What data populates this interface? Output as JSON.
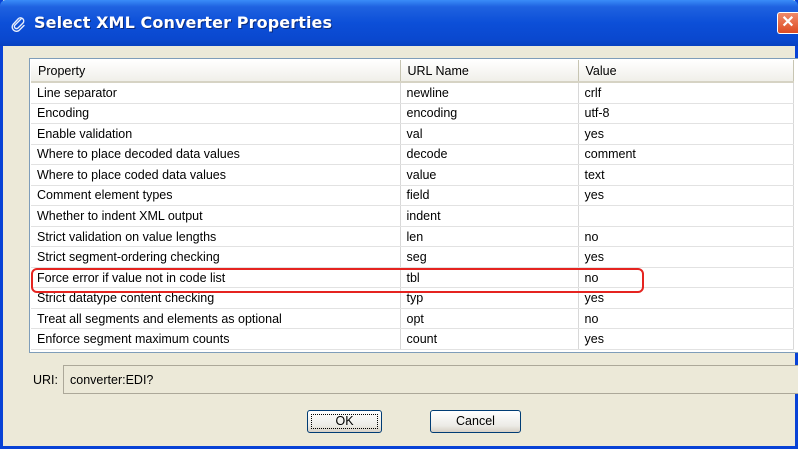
{
  "window": {
    "title": "Select XML Converter Properties",
    "close_glyph": "✕",
    "icon": "paperclip-icon"
  },
  "table": {
    "columns": [
      "Property",
      "URL Name",
      "Value"
    ],
    "rows": [
      {
        "property": "Line separator",
        "url": "newline",
        "value": "crlf"
      },
      {
        "property": "Encoding",
        "url": "encoding",
        "value": "utf-8"
      },
      {
        "property": "Enable validation",
        "url": "val",
        "value": "yes"
      },
      {
        "property": "Where to place decoded data values",
        "url": "decode",
        "value": "comment"
      },
      {
        "property": "Where to place coded data values",
        "url": "value",
        "value": "text"
      },
      {
        "property": "Comment element types",
        "url": "field",
        "value": "yes"
      },
      {
        "property": "Whether to indent XML output",
        "url": "indent",
        "value": ""
      },
      {
        "property": "Strict validation on value lengths",
        "url": "len",
        "value": "no"
      },
      {
        "property": "Strict segment-ordering checking",
        "url": "seg",
        "value": "yes"
      },
      {
        "property": "Force error if value not in code list",
        "url": "tbl",
        "value": "no"
      },
      {
        "property": "Strict datatype content checking",
        "url": "typ",
        "value": "yes"
      },
      {
        "property": "Treat all segments and elements as optional",
        "url": "opt",
        "value": "no"
      },
      {
        "property": "Enforce segment maximum counts",
        "url": "count",
        "value": "yes"
      }
    ],
    "highlighted_row_index": 9,
    "highlight_color": "#e52420"
  },
  "uri": {
    "label": "URI:",
    "value": "converter:EDI?"
  },
  "buttons": {
    "ok": "OK",
    "cancel": "Cancel"
  },
  "colors": {
    "titlebar": "#0c4fd8",
    "dialog_bg": "#ece9d8"
  }
}
